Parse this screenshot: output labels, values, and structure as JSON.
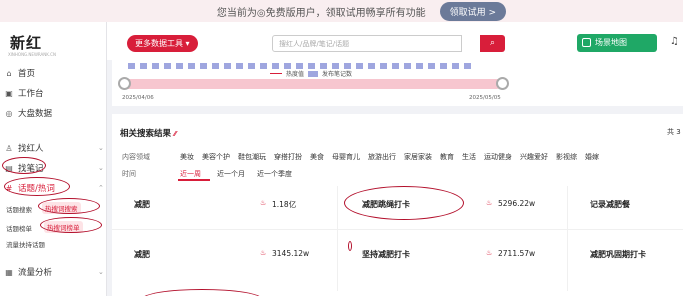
{
  "banner": {
    "text": "您当前为◎免费版用户，领取试用畅享所有功能",
    "button": "领取试用 >"
  },
  "sidebar": {
    "logo": "新红",
    "logo_sub": "XINHONG.NEWRANK.CN",
    "items": [
      {
        "label": "首页",
        "icon": "home-icon"
      },
      {
        "label": "工作台",
        "icon": "workbench-icon"
      },
      {
        "label": "大盘数据",
        "icon": "dashboard-icon"
      },
      {
        "label": "找红人",
        "icon": "user-icon"
      },
      {
        "label": "找笔记",
        "icon": "note-icon"
      },
      {
        "label": "话题/热词",
        "icon": "topic-icon"
      },
      {
        "label": "流量分析",
        "icon": "traffic-icon"
      }
    ],
    "sub_items": [
      "话题搜索",
      "热搜词搜索",
      "话题榜单",
      "热搜词榜单",
      "流量扶持话题"
    ]
  },
  "topbar": {
    "more_tools": "更多数据工具",
    "search_placeholder": "搜红人/品牌/笔记/话题",
    "map_button": "场景地图"
  },
  "chart": {
    "legend_line": "热度值",
    "legend_box": "发布笔记数",
    "start_date": "2025/04/06",
    "end_date": "2025/05/05",
    "bars_total": 29,
    "range_start": 0,
    "range_end": 1
  },
  "results": {
    "title": "相关搜索结果",
    "count": "共 3",
    "filter_label": "内容领域",
    "categories": [
      "美妆",
      "美容个护",
      "鞋包潮玩",
      "穿搭打扮",
      "美食",
      "母婴育儿",
      "旅游出行",
      "家居家装",
      "教育",
      "生活",
      "运动健身",
      "兴趣爱好",
      "影视综",
      "婚嫁"
    ],
    "time_label": "时间",
    "time_options": [
      "近一周",
      "近一个月",
      "近一个季度"
    ],
    "keywords": [
      {
        "name": "减肥",
        "value": "1.18亿"
      },
      {
        "name": "减肥跳绳打卡",
        "value": "5296.22w"
      },
      {
        "name": "记录减肥餐",
        "value": ""
      },
      {
        "name": "减肥",
        "value": "3145.12w"
      },
      {
        "name": "坚持减肥打卡",
        "value": "2711.57w"
      },
      {
        "name": "减肥巩固期打卡",
        "value": ""
      }
    ]
  },
  "colors": {
    "accent": "#d81e3a",
    "green": "#1fa866",
    "bar": "#9fa6df"
  }
}
